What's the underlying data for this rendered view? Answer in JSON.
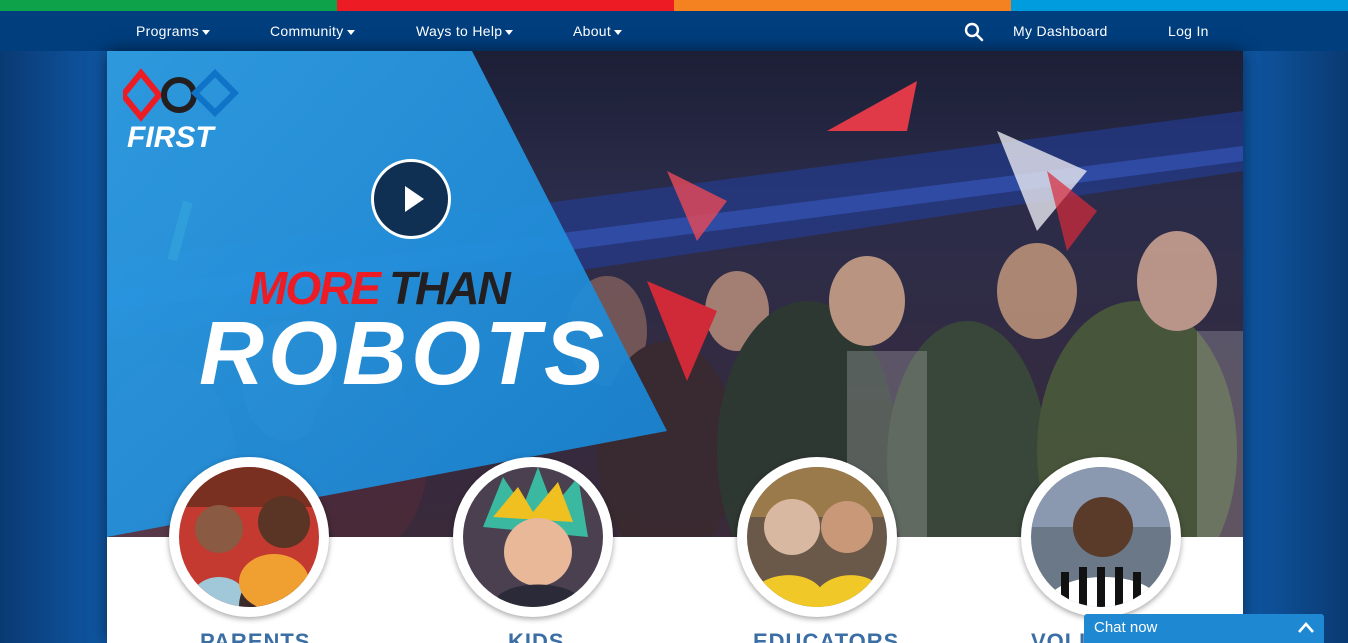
{
  "colors": {
    "strip": [
      "#0ea34a",
      "#ed1c24",
      "#f58220",
      "#009cde"
    ],
    "nav_bg": "#003e7e",
    "accent": "#009cde",
    "chat_bg": "#1e88d2"
  },
  "nav": {
    "items": [
      {
        "label": "Programs"
      },
      {
        "label": "Community"
      },
      {
        "label": "Ways to Help"
      },
      {
        "label": "About"
      }
    ],
    "dashboard": "My Dashboard",
    "login": "Log In",
    "search_icon": "search-icon"
  },
  "hero": {
    "logo_text": "FIRST",
    "tagline_part1": "MORE",
    "tagline_part2": "THAN",
    "tagline_part3": "ROBOTS",
    "play_icon": "play-icon"
  },
  "categories": [
    {
      "label": "PARENTS"
    },
    {
      "label": "KIDS"
    },
    {
      "label": "EDUCATORS"
    },
    {
      "label": "VOLU"
    }
  ],
  "chat": {
    "label": "Chat now",
    "icon": "chevron-up-icon"
  }
}
